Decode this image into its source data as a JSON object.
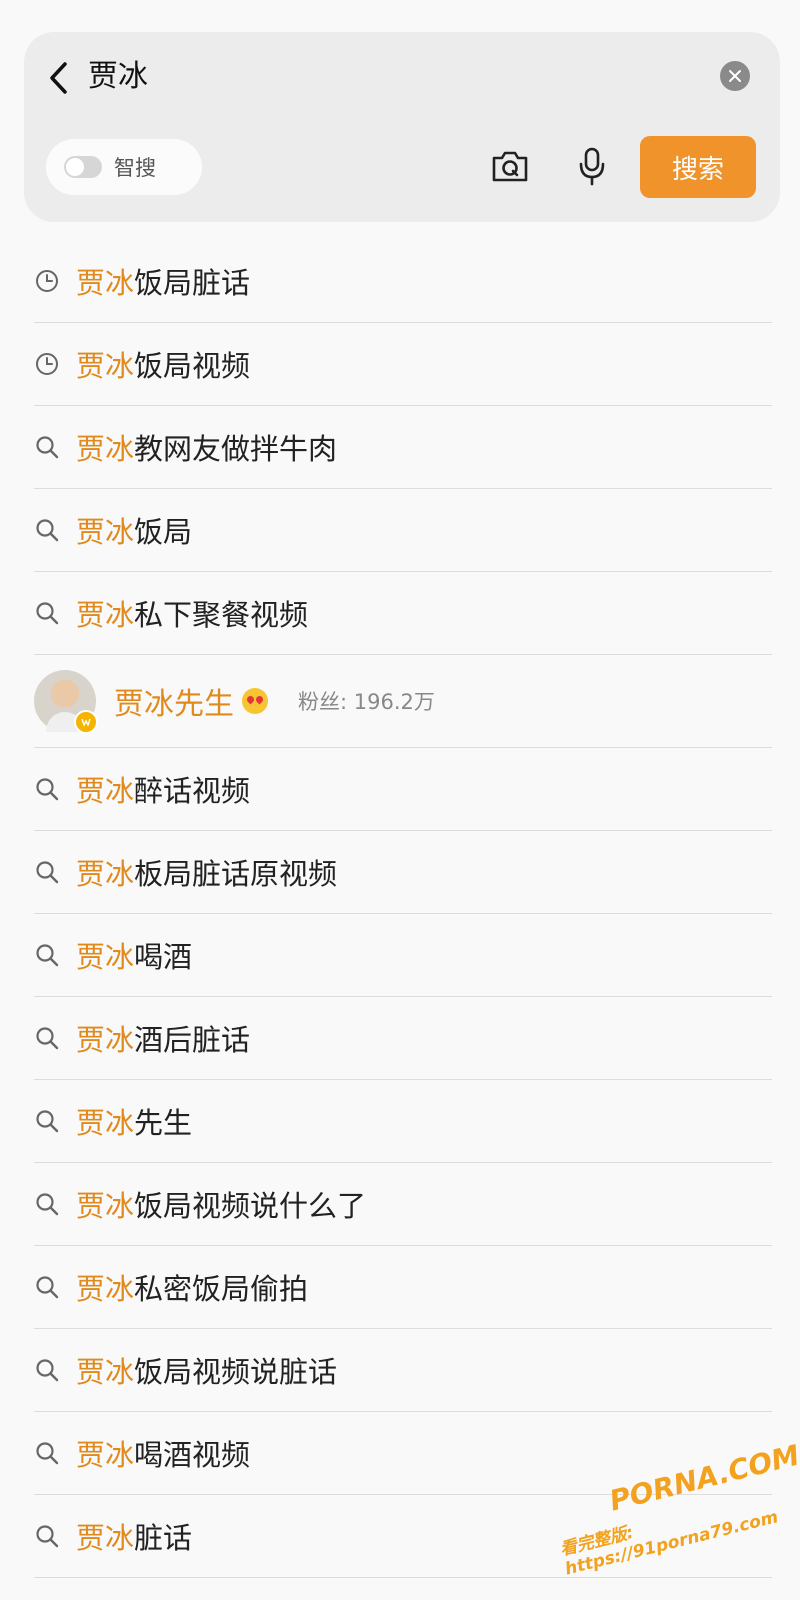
{
  "search": {
    "query": "贾冰",
    "smart_label": "智搜",
    "search_button": "搜索",
    "clear_icon": "close-icon",
    "back_icon": "chevron-left-icon",
    "camera_icon": "camera-icon",
    "mic_icon": "microphone-icon"
  },
  "suggestions_top": [
    {
      "icon": "clock-icon",
      "prefix": "贾冰",
      "rest": "饭局脏话"
    },
    {
      "icon": "clock-icon",
      "prefix": "贾冰",
      "rest": "饭局视频"
    },
    {
      "icon": "search-icon",
      "prefix": "贾冰",
      "rest": "教网友做拌牛肉"
    },
    {
      "icon": "search-icon",
      "prefix": "贾冰",
      "rest": "饭局"
    },
    {
      "icon": "search-icon",
      "prefix": "贾冰",
      "rest": "私下聚餐视频"
    }
  ],
  "user_result": {
    "name": "贾冰先生",
    "fans": "粉丝: 196.2万"
  },
  "suggestions_bottom": [
    {
      "icon": "search-icon",
      "prefix": "贾冰",
      "rest": "醉话视频"
    },
    {
      "icon": "search-icon",
      "prefix": "贾冰",
      "rest": "板局脏话原视频"
    },
    {
      "icon": "search-icon",
      "prefix": "贾冰",
      "rest": "喝酒"
    },
    {
      "icon": "search-icon",
      "prefix": "贾冰",
      "rest": "酒后脏话"
    },
    {
      "icon": "search-icon",
      "prefix": "贾冰",
      "rest": "先生"
    },
    {
      "icon": "search-icon",
      "prefix": "贾冰",
      "rest": "饭局视频说什么了"
    },
    {
      "icon": "search-icon",
      "prefix": "贾冰",
      "rest": "私密饭局偷拍"
    },
    {
      "icon": "search-icon",
      "prefix": "贾冰",
      "rest": "饭局视频说脏话"
    },
    {
      "icon": "search-icon",
      "prefix": "贾冰",
      "rest": "喝酒视频"
    },
    {
      "icon": "search-icon",
      "prefix": "贾冰",
      "rest": "脏话"
    }
  ],
  "watermark": {
    "logo": "PORNA.COM",
    "url": "看完整版: https://91porna79.com"
  },
  "colors": {
    "accent": "#f0932b",
    "highlight": "#e08a1e",
    "card": "#ececec"
  }
}
